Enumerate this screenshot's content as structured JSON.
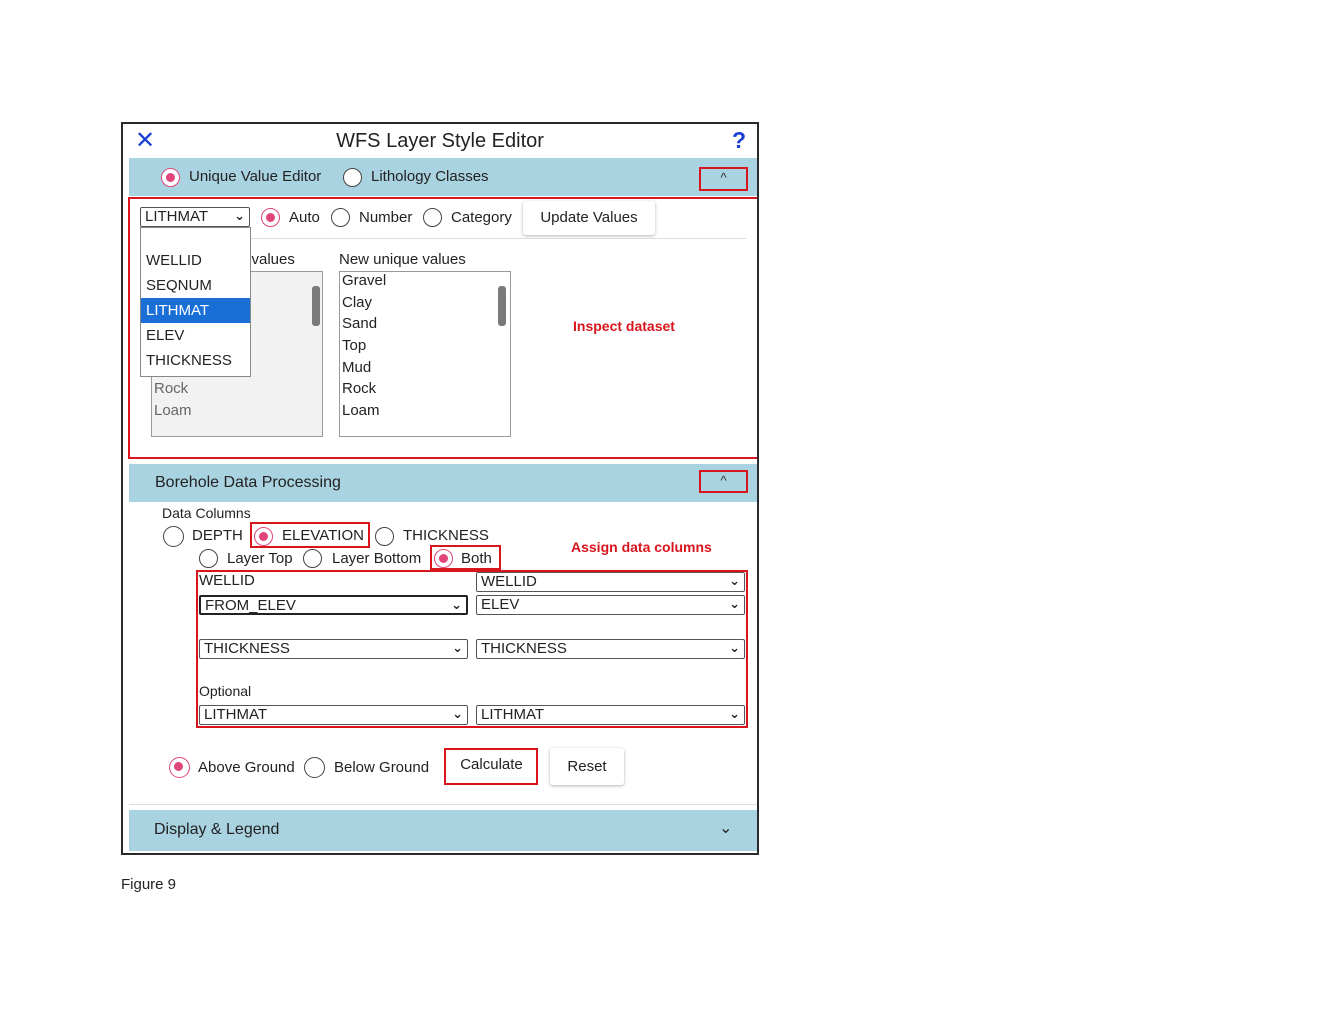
{
  "window": {
    "title": "WFS Layer Style Editor",
    "close_icon": "close-icon",
    "help_label": "?"
  },
  "style_section": {
    "mode_options": [
      {
        "label": "Unique Value Editor",
        "selected": true
      },
      {
        "label": "Lithology Classes",
        "selected": false
      }
    ],
    "collapse_glyph": "^",
    "field_select_value": "LITHMAT",
    "type_options": [
      {
        "label": "Auto",
        "selected": true
      },
      {
        "label": "Number",
        "selected": false
      },
      {
        "label": "Category",
        "selected": false
      }
    ],
    "update_button": "Update Values",
    "dropdown_options": [
      "WELLID",
      "SEQNUM",
      "LITHMAT",
      "ELEV",
      "THICKNESS"
    ],
    "dropdown_selected": "LITHMAT",
    "current_values_label_fragment": "e values",
    "current_values_visible": [
      "Rock",
      "Loam"
    ],
    "new_values_label": "New unique values",
    "new_values": [
      "Gravel",
      "Clay",
      "Sand",
      "Top",
      "Mud",
      "Rock",
      "Loam"
    ]
  },
  "borehole_section": {
    "title": "Borehole Data Processing",
    "collapse_glyph": "^",
    "data_columns_label": "Data Columns",
    "column_options": [
      {
        "label": "DEPTH",
        "selected": false
      },
      {
        "label": "ELEVATION",
        "selected": true
      },
      {
        "label": "THICKNESS",
        "selected": false
      }
    ],
    "layer_options": [
      {
        "label": "Layer Top",
        "selected": false
      },
      {
        "label": "Layer Bottom",
        "selected": false
      },
      {
        "label": "Both",
        "selected": true
      }
    ],
    "well_label": "WELLID",
    "well_select": "WELLID",
    "elev_left": "FROM_ELEV",
    "elev_right": "ELEV",
    "thick_left": "THICKNESS",
    "thick_right": "THICKNESS",
    "optional_label": "Optional",
    "optional_left": "LITHMAT",
    "optional_right": "LITHMAT",
    "ground_options": [
      {
        "label": "Above Ground",
        "selected": true
      },
      {
        "label": "Below Ground",
        "selected": false
      }
    ],
    "calculate_button": "Calculate",
    "reset_button": "Reset"
  },
  "display_section": {
    "title": "Display & Legend",
    "expand_glyph": "⌄"
  },
  "annotations": {
    "inspect": "Inspect dataset",
    "assign": "Assign data columns"
  },
  "caption": "Figure 9",
  "colors": {
    "accent": "#e0457b",
    "section_bar": "#a9d3e0",
    "annotation_red": "#d8141d",
    "link_blue": "#1c3fd1"
  }
}
